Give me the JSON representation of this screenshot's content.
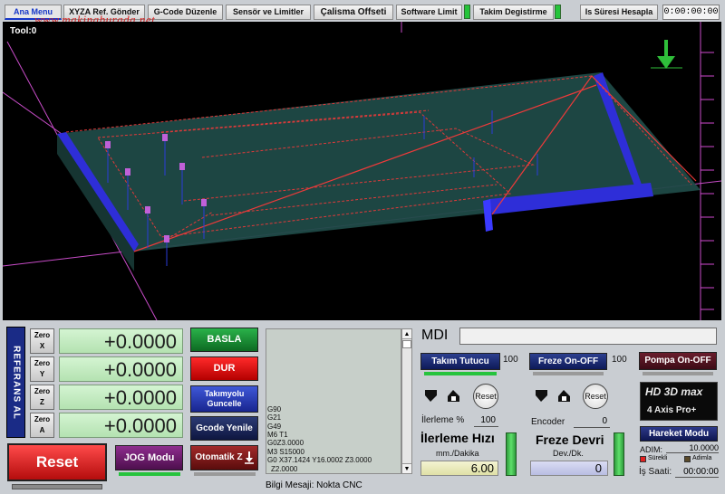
{
  "toolbar": {
    "tabs": [
      {
        "label": "Ana Menu"
      },
      {
        "label": "XYZA Ref. Gönder"
      },
      {
        "label": "G-Code Düzenle"
      },
      {
        "label": "Sensör ve Limitler"
      },
      {
        "label": "Çalisma Offseti"
      },
      {
        "label": "Software Limit"
      },
      {
        "label": "Takim Degistirme"
      },
      {
        "label": "Is Süresi Hesapla"
      }
    ],
    "timer": "0:00:00:00",
    "watermark": "www.makinaburada.net"
  },
  "viewport": {
    "tool_label": "Tool:0",
    "colors": {
      "bed": "#1e4f4a",
      "rails": "#2b2bd8",
      "toolpath": "#e03030",
      "grid": "#ff60ff"
    }
  },
  "dro": {
    "ref_label": "REFERANS AL",
    "axes": [
      {
        "zero": "Zero",
        "axis": "X",
        "value": "+0.0000"
      },
      {
        "zero": "Zero",
        "axis": "Y",
        "value": "+0.0000"
      },
      {
        "zero": "Zero",
        "axis": "Z",
        "value": "+0.0000"
      },
      {
        "zero": "Zero",
        "axis": "A",
        "value": "+0.0000"
      }
    ],
    "reset_label": "Reset",
    "jog_label": "JOG Modu"
  },
  "controls": {
    "start_label": "BASLA",
    "stop_label": "DUR",
    "toolpath_label_1": "Takımyolu",
    "toolpath_label_2": "Guncelle",
    "gcode_refresh_label": "Gcode Yenile",
    "auto_z_label": "Otomatik Z"
  },
  "gcode": {
    "lines": [
      "G90",
      "G21",
      "G49",
      "M6 T1",
      "G0Z3.0000",
      "M3 S15000",
      "G0 X37.1424 Y16.0002 Z3.0000",
      "Z2.0000"
    ]
  },
  "mdi": {
    "label": "MDI",
    "value": ""
  },
  "status": {
    "label": "Bilgi Mesaji:",
    "message": "Nokta CNC"
  },
  "spindle": {
    "tool_holder_label": "Takım Tutucu",
    "tool_holder_value": "100",
    "spindle_toggle_label": "Freze On-OFF",
    "spindle_toggle_value": "100",
    "pump_label": "Pompa On-OFF",
    "reset_small": "Reset",
    "feed_percent_label": "İlerleme %",
    "feed_percent_value": "100",
    "encoder_label": "Encoder",
    "encoder_value": "0",
    "feed_title": "İlerleme Hızı",
    "feed_unit": "mm./Dakika",
    "feed_value": "6.00",
    "speed_title": "Freze Devri",
    "speed_unit": "Dev./Dk.",
    "speed_value": "0"
  },
  "brand": {
    "line1": "HD 3D max",
    "line2": "4 Axis Pro+"
  },
  "motion": {
    "mode_label": "Hareket Modu",
    "step_label": "ADIM:",
    "step_value": "10.0000",
    "cont_label": "Sürekli",
    "step_mode_label": "Adimla",
    "worktime_label": "İş Saati:",
    "worktime_value": "00:00:00"
  }
}
